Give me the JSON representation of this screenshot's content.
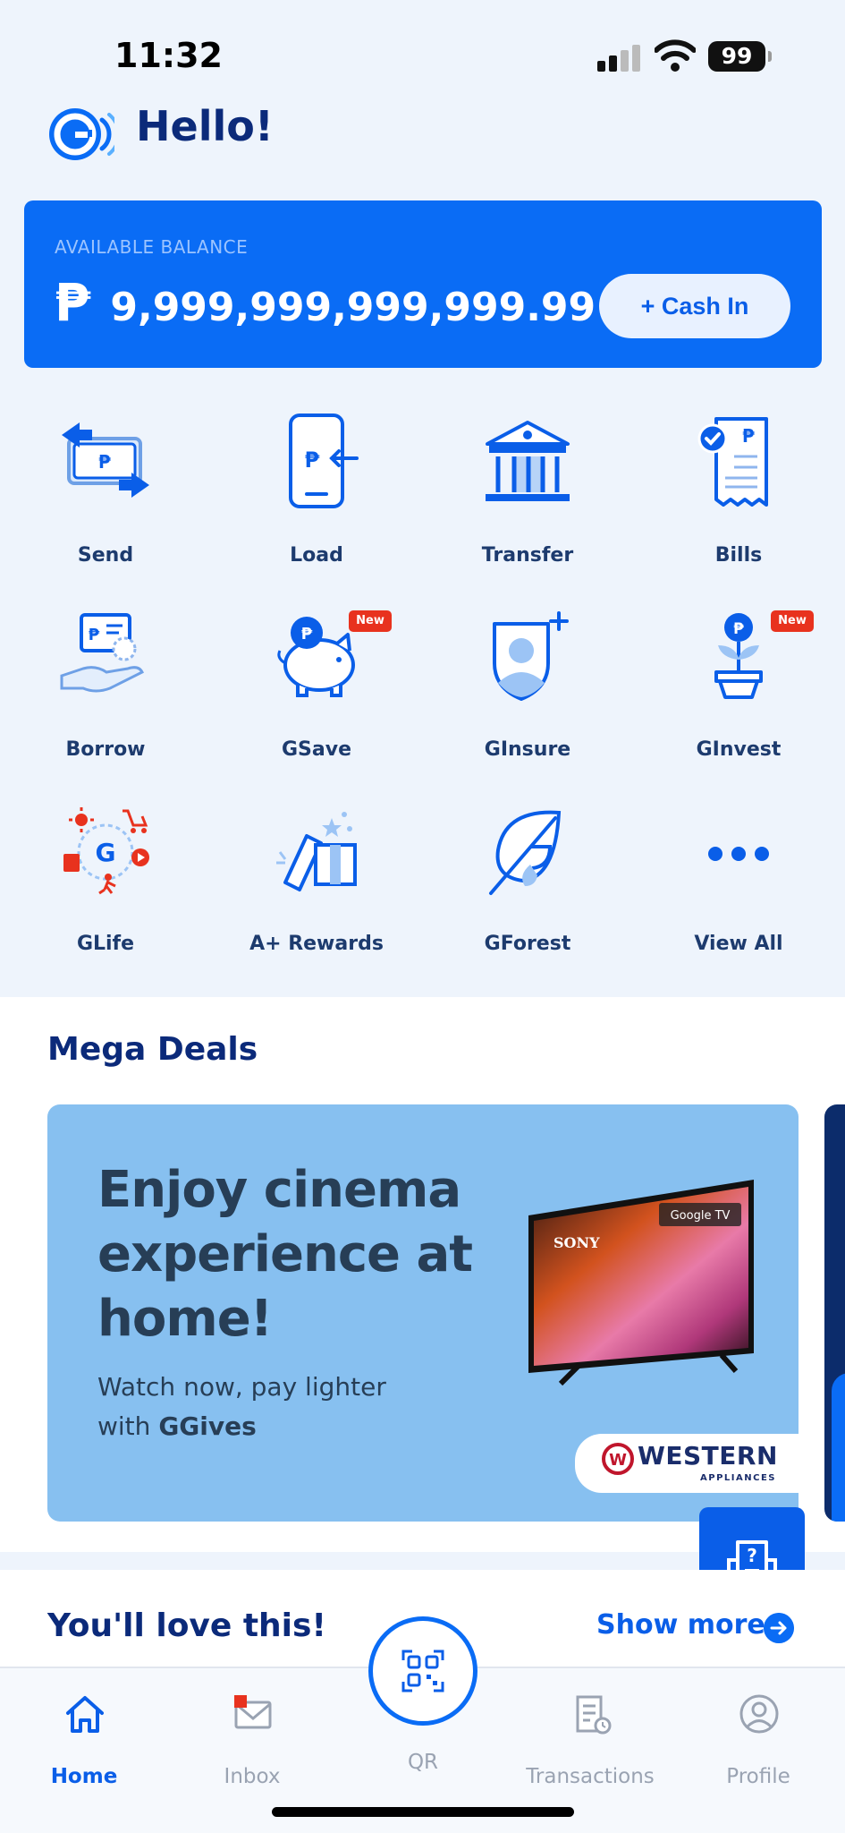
{
  "status_bar": {
    "time": "11:32",
    "battery": "99"
  },
  "header": {
    "greeting": "Hello!"
  },
  "balance": {
    "label": "AVAILABLE BALANCE",
    "currency": "₱",
    "amount": "9,999,999,999,999.99",
    "cash_in_label": "+ Cash In"
  },
  "services": [
    {
      "label": "Send",
      "icon": "send-icon"
    },
    {
      "label": "Load",
      "icon": "load-icon"
    },
    {
      "label": "Transfer",
      "icon": "bank-icon"
    },
    {
      "label": "Bills",
      "icon": "bills-icon"
    },
    {
      "label": "Borrow",
      "icon": "borrow-icon"
    },
    {
      "label": "GSave",
      "icon": "piggy-bank-icon",
      "badge": "New"
    },
    {
      "label": "GInsure",
      "icon": "shield-person-icon"
    },
    {
      "label": "GInvest",
      "icon": "plant-icon",
      "badge": "New"
    },
    {
      "label": "GLife",
      "icon": "glife-icon"
    },
    {
      "label": "A+ Rewards",
      "icon": "gift-icon"
    },
    {
      "label": "GForest",
      "icon": "leaf-icon"
    },
    {
      "label": "View All",
      "icon": "more-dots-icon"
    }
  ],
  "mega_deals": {
    "title": "Mega Deals",
    "banner": {
      "headline": "Enjoy cinema experience at home!",
      "sub_line1": "Watch now, pay lighter",
      "sub_line2_prefix": "with ",
      "sub_line2_bold": "GGives",
      "tv_brand": "SONY",
      "tv_badge": "Google TV",
      "partner_name": "WESTERN",
      "partner_sub": "APPLIANCES"
    }
  },
  "love": {
    "title": "You'll love this!",
    "show_more": "Show more"
  },
  "nav": {
    "home": "Home",
    "inbox": "Inbox",
    "qr": "QR",
    "transactions": "Transactions",
    "profile": "Profile"
  },
  "colors": {
    "primary": "#0a6cf5",
    "navy": "#0b2a7a",
    "badge": "#e8321e"
  }
}
